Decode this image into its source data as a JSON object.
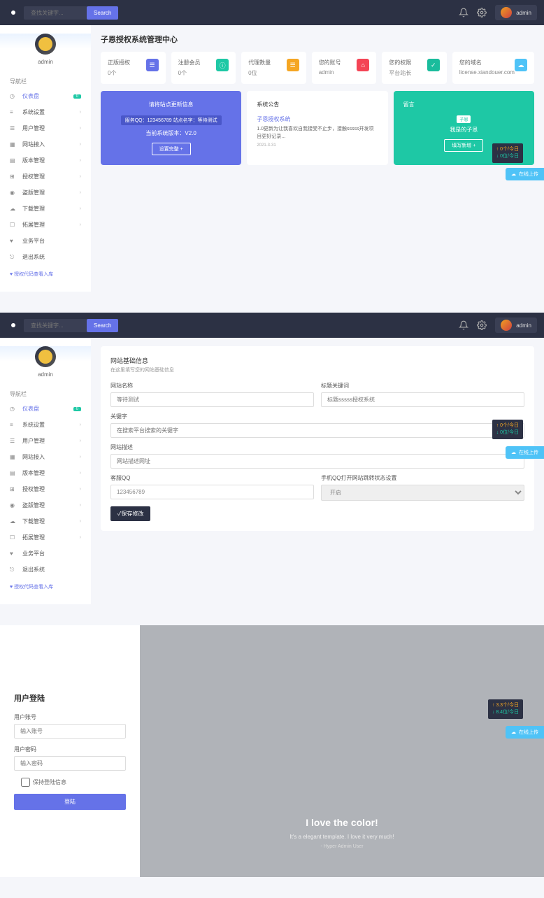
{
  "topbar": {
    "search_placeholder": "查找关键字...",
    "search_btn": "Search",
    "username": "admin"
  },
  "sidebar": {
    "username": "admin",
    "section": "导航栏",
    "items": [
      {
        "icon": "◷",
        "label": "仪表盘",
        "badge": "0",
        "active": true
      },
      {
        "icon": "≡",
        "label": "系统设置",
        "chev": "›"
      },
      {
        "icon": "☰",
        "label": "用户管理",
        "chev": "›"
      },
      {
        "icon": "▦",
        "label": "网站接入",
        "chev": "›"
      },
      {
        "icon": "▤",
        "label": "版本管理",
        "chev": "›"
      },
      {
        "icon": "⊞",
        "label": "授权管理",
        "chev": "›"
      },
      {
        "icon": "◉",
        "label": "盗版管理",
        "chev": "›"
      },
      {
        "icon": "☁",
        "label": "下载管理",
        "chev": "›"
      },
      {
        "icon": "☐",
        "label": "拓展管理",
        "chev": "›"
      },
      {
        "icon": "♥",
        "label": "业务平台"
      },
      {
        "icon": "⎋",
        "label": "退出系统"
      }
    ],
    "footer": "♥ 授权代码查看入库"
  },
  "dash": {
    "title": "子恩授权系统管理中心",
    "stats": [
      {
        "label": "正版授权",
        "value": "0个",
        "icon": "☰",
        "cls": "ic-purple"
      },
      {
        "label": "注册会员",
        "value": "0个",
        "icon": "ⓘ",
        "cls": "ic-green"
      },
      {
        "label": "代理数量",
        "value": "0位",
        "icon": "☰",
        "cls": "ic-orange"
      },
      {
        "label": "您的账号",
        "value": "admin",
        "icon": "⌂",
        "cls": "ic-red"
      },
      {
        "label": "您的权限",
        "value": "平台站长",
        "icon": "✓",
        "cls": "ic-teal"
      },
      {
        "label": "您的域名",
        "value": "license.xiandouer.com",
        "icon": "☁",
        "cls": "ic-blue"
      }
    ],
    "p1": {
      "title": "请将站点更新信息",
      "tag": "服务QQ：123456789  站点名字：等待测试",
      "ver": "当前系统版本：V2.0",
      "btn": "设置完整  +"
    },
    "p2": {
      "title": "系统公告",
      "link": "子恩授权系统",
      "txt": "1.0更新为让我喜欢自我接受不止步，接触sssss开发项目更好记录...",
      "date": "2021-3-31"
    },
    "p3": {
      "title": "留言",
      "tag": "子恩",
      "msg": "我是的子恩",
      "btn": "填写新增  +"
    },
    "float": {
      "up": "↑ 0个/今日",
      "down": "↓ 0位/今日"
    }
  },
  "form": {
    "title": "网站基础信息",
    "sub": "在这里填写您的网站基础信息",
    "name_label": "网站名称",
    "name_ph": "等待测试",
    "kw_title_label": "标题关键词",
    "kw_title_ph": "标题sssss授权系统",
    "kw_label": "关键字",
    "kw_ph": "在搜索平台搜索的关键字",
    "desc_label": "网站描述",
    "desc_ph": "网站描述网址",
    "qq_label": "客服QQ",
    "qq_val": "123456789",
    "mqq_label": "手机QQ打开网站跳转状态设置",
    "mqq_val": "开启",
    "submit": "✓保存修改",
    "float": {
      "up": "↑ 0个/今日",
      "down": "↓ 0位/今日"
    }
  },
  "login": {
    "title": "用户登陆",
    "user_label": "用户账号",
    "user_ph": "输入账号",
    "pass_label": "用户密码",
    "pass_ph": "输入密码",
    "remember": "保持登陆信息",
    "btn": "登陆",
    "hero_title": "I love the color!",
    "hero_sub": "It's a elegant template. I love it very much!",
    "hero_cred": "- Hyper Admin User",
    "float": {
      "up": "↑ 3.3个/今日",
      "down": "↓ 8.4位/今日"
    }
  },
  "chat_label": "在线上传"
}
